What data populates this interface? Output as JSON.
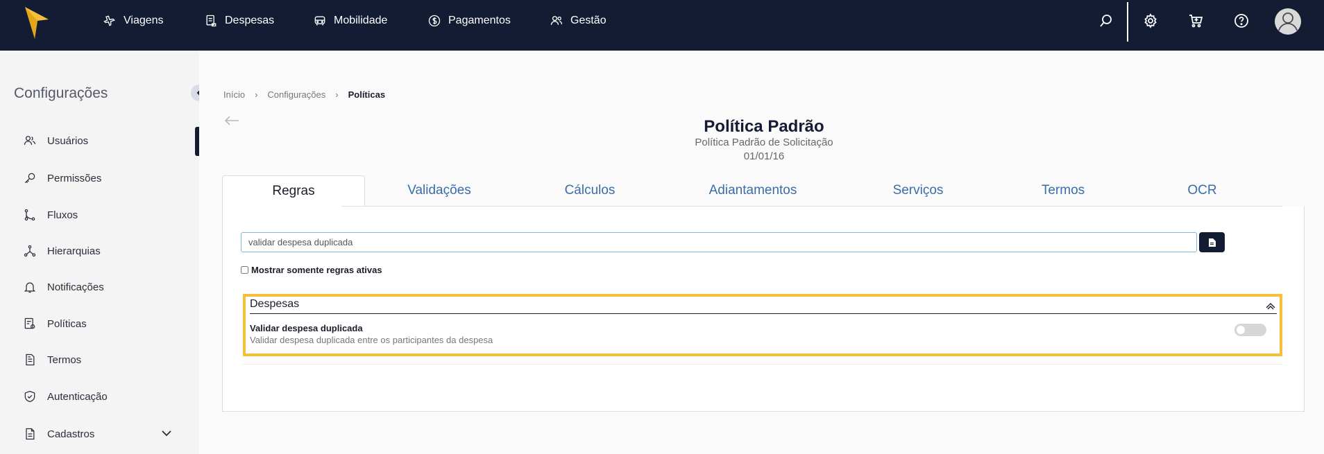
{
  "topnav": {
    "items": [
      {
        "label": "Viagens",
        "icon": "airplane-icon"
      },
      {
        "label": "Despesas",
        "icon": "receipt-icon"
      },
      {
        "label": "Mobilidade",
        "icon": "car-icon"
      },
      {
        "label": "Pagamentos",
        "icon": "dollar-icon"
      },
      {
        "label": "Gestão",
        "icon": "people-icon"
      }
    ],
    "icons": [
      "search-icon",
      "gear-icon",
      "cart-icon",
      "help-icon",
      "avatar-icon"
    ],
    "colors": {
      "background": "#141c33",
      "logo": "#f6bf3b"
    }
  },
  "sidebar": {
    "title": "Configurações",
    "items": [
      {
        "label": "Usuários",
        "icon": "users-icon"
      },
      {
        "label": "Permissões",
        "icon": "key-icon"
      },
      {
        "label": "Fluxos",
        "icon": "flow-icon"
      },
      {
        "label": "Hierarquias",
        "icon": "hierarchy-icon"
      },
      {
        "label": "Notificações",
        "icon": "bell-icon"
      },
      {
        "label": "Políticas",
        "icon": "policy-icon"
      },
      {
        "label": "Termos",
        "icon": "document-icon"
      },
      {
        "label": "Autenticação",
        "icon": "shield-icon"
      },
      {
        "label": "Cadastros",
        "icon": "file-icon"
      }
    ]
  },
  "breadcrumb": [
    "Início",
    "Configurações",
    "Políticas"
  ],
  "page": {
    "title": "Política Padrão",
    "subtitle": "Política Padrão de Solicitação",
    "date": "01/01/16"
  },
  "tabs": [
    {
      "label": "Regras",
      "active": true
    },
    {
      "label": "Validações",
      "active": false
    },
    {
      "label": "Cálculos",
      "active": false
    },
    {
      "label": "Adiantamentos",
      "active": false
    },
    {
      "label": "Serviços",
      "active": false
    },
    {
      "label": "Termos",
      "active": false
    },
    {
      "label": "OCR",
      "active": false
    }
  ],
  "filter": {
    "search_value": "validar despesa duplicada",
    "checkbox_label": "Mostrar somente regras ativas",
    "checkbox_checked": false
  },
  "rules_group": {
    "title": "Despesas",
    "highlight_color": "#f6bf3b",
    "rule": {
      "title": "Validar despesa duplicada",
      "description": "Validar despesa duplicada entre os participantes da despesa",
      "enabled": false
    }
  }
}
